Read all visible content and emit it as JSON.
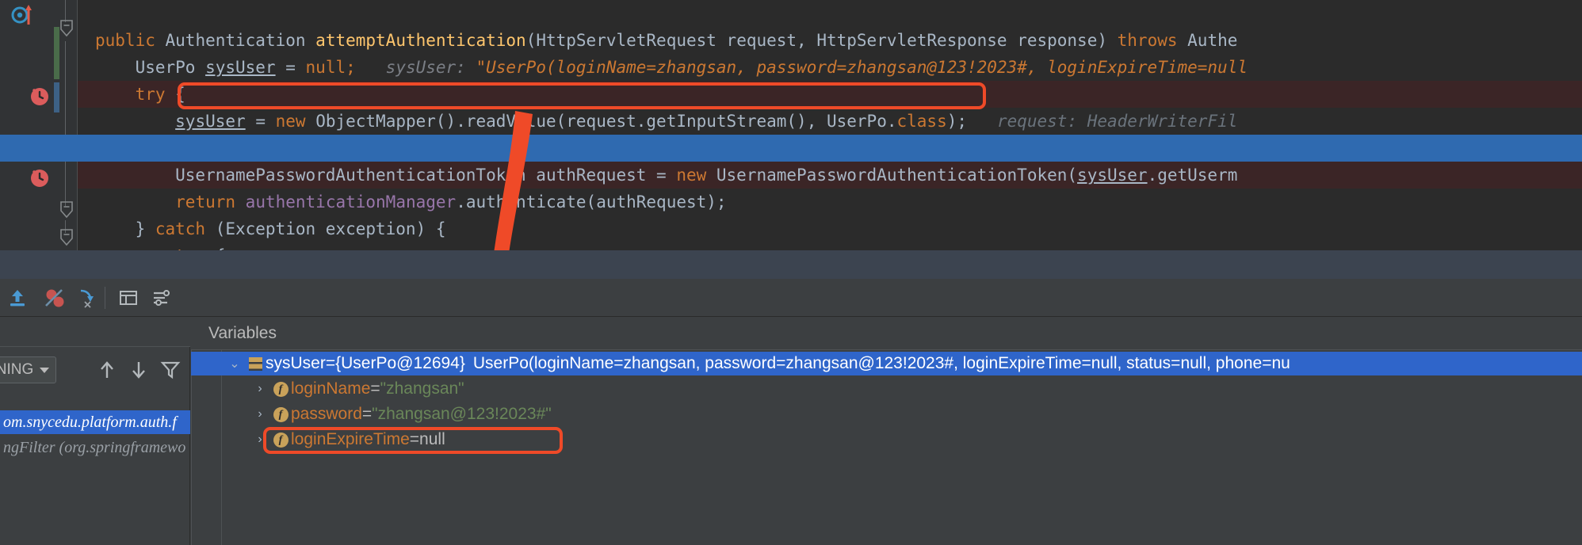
{
  "editor": {
    "lines": [
      {
        "id": "line-signature",
        "segments": [
          {
            "t": "public ",
            "c": "k"
          },
          {
            "t": "Authentication ",
            "c": "t"
          },
          {
            "t": "attemptAuthentication",
            "c": "fn"
          },
          {
            "t": "(HttpServletRequest request, HttpServletResponse response) ",
            "c": "t"
          },
          {
            "t": "throws ",
            "c": "k"
          },
          {
            "t": "Authe",
            "c": "t"
          }
        ],
        "plain": "public Authentication attemptAuthentication(HttpServletRequest request, HttpServletResponse response) throws Authe"
      },
      {
        "id": "line-sysuser-decl",
        "segments": [
          {
            "t": "    UserPo ",
            "c": "t"
          },
          {
            "t": "sysUser",
            "c": "u"
          },
          {
            "t": " = ",
            "c": "t"
          },
          {
            "t": "null;",
            "c": "k"
          }
        ],
        "plain": "    UserPo sysUser = null;",
        "hint_label": "sysUser:",
        "hint_value": "\"UserPo(loginName=zhangsan, password=zhangsan@123!2023#, loginExpireTime=null"
      },
      {
        "id": "line-try-1",
        "segments": [
          {
            "t": "    try ",
            "c": "k"
          },
          {
            "t": "{",
            "c": "t"
          }
        ],
        "plain": "    try {"
      },
      {
        "id": "line-readvalue",
        "segments": [
          {
            "t": "        ",
            "c": "t"
          },
          {
            "t": "sysUser",
            "c": "u"
          },
          {
            "t": " = ",
            "c": "t"
          },
          {
            "t": "new ",
            "c": "k"
          },
          {
            "t": "ObjectMapper().readValue(request.getInputStream(), UserPo.",
            "c": "t"
          },
          {
            "t": "class",
            "c": "k"
          },
          {
            "t": ");",
            "c": "t"
          }
        ],
        "plain": "        sysUser = new ObjectMapper().readValue(request.getInputStream(), UserPo.class);",
        "hint_label": "request:",
        "hint_value": "HeaderWriterFil"
      },
      {
        "id": "line-authrequest",
        "segments": [
          {
            "t": "        UsernamePasswordAuthenticationToken authRequest = ",
            "c": "t"
          },
          {
            "t": "new ",
            "c": "k"
          },
          {
            "t": "UsernamePasswordAuthenticationToken(",
            "c": "t"
          },
          {
            "t": "sysUser",
            "c": "u"
          },
          {
            "t": ".getUserm",
            "c": "t"
          }
        ],
        "plain": "        UsernamePasswordAuthenticationToken authRequest = new UsernamePasswordAuthenticationToken(sysUser.getUserm"
      },
      {
        "id": "line-return-authenticate",
        "segments": [
          {
            "t": "        ",
            "c": "t"
          },
          {
            "t": "return ",
            "c": "k"
          },
          {
            "t": "authenticationManager",
            "c": "fld"
          },
          {
            "t": ".authenticate(authRequest);",
            "c": "t"
          }
        ],
        "plain": "        return authenticationManager.authenticate(authRequest);"
      },
      {
        "id": "line-catch",
        "segments": [
          {
            "t": "    } ",
            "c": "t"
          },
          {
            "t": "catch ",
            "c": "k"
          },
          {
            "t": "(Exception exception) {",
            "c": "t"
          }
        ],
        "plain": "    } catch (Exception exception) {"
      },
      {
        "id": "line-try-2",
        "segments": [
          {
            "t": "        try ",
            "c": "k"
          },
          {
            "t": "{",
            "c": "t"
          }
        ],
        "plain": "        try {"
      }
    ]
  },
  "annotations": {
    "highlight_box_1": "readValue statement outlined in red",
    "highlight_box_2": "password field outlined in red",
    "arrow_color": "#ef4a28"
  },
  "debug_toolbar": {
    "buttons": [
      {
        "name": "restore-layout-button",
        "icon": "upload-arrow-icon"
      },
      {
        "name": "mute-breakpoints-button",
        "icon": "crossed-breakpoint-icon"
      },
      {
        "name": "step-over-cursor-icon-button",
        "icon": "step-arrow-icon"
      },
      {
        "name": "settings-grid-button",
        "icon": "grid-icon"
      },
      {
        "name": "layout-settings-button",
        "icon": "list-settings-icon"
      }
    ]
  },
  "frames": {
    "header_title": "",
    "thread_selector": "NNING",
    "up_button": "↑",
    "down_button": "↓",
    "filter_button": "filter",
    "add_button": "+",
    "remove_button": "−",
    "items": [
      {
        "label": "om.snycedu.platform.auth.f",
        "selected": true
      },
      {
        "label": "ngFilter (org.springframewo",
        "selected": false
      }
    ]
  },
  "variables": {
    "header": "Variables",
    "rows": [
      {
        "indent": 0,
        "twisty": "⌄",
        "icon": "object-node-icon",
        "name": "sysUser",
        "eq": " = ",
        "value": "{UserPo@12694}",
        "extra": "UserPo(loginName=zhangsan, password=zhangsan@123!2023#, loginExpireTime=null, status=null, phone=nu",
        "selected": true,
        "value_kind": "object"
      },
      {
        "indent": 1,
        "twisty": "›",
        "icon": "field-icon",
        "name": "loginName",
        "eq": " = ",
        "value": "\"zhangsan\"",
        "extra": "",
        "selected": false,
        "value_kind": "string"
      },
      {
        "indent": 1,
        "twisty": "›",
        "icon": "field-icon",
        "name": "password",
        "eq": " = ",
        "value": "\"zhangsan@123!2023#\"",
        "extra": "",
        "selected": false,
        "value_kind": "string",
        "outlined": true
      },
      {
        "indent": 1,
        "twisty": "›",
        "icon": "field-icon",
        "name": "loginExpireTime",
        "eq": " = ",
        "value": "null",
        "extra": "",
        "selected": false,
        "value_kind": "null"
      }
    ]
  },
  "colors": {
    "editor_bg": "#2b2b2b",
    "gutter_bg": "#313335",
    "panel_bg": "#3c3f41",
    "selection_blue": "#2f6ab0",
    "tree_selection_blue": "#2f65ca",
    "exec_line_red": "#3b2526",
    "annotation_red": "#ef4a28",
    "string_green": "#6a8759",
    "keyword_orange": "#cc7832",
    "method_yellow": "#ffc66d",
    "text_grey": "#a9b7c6"
  }
}
